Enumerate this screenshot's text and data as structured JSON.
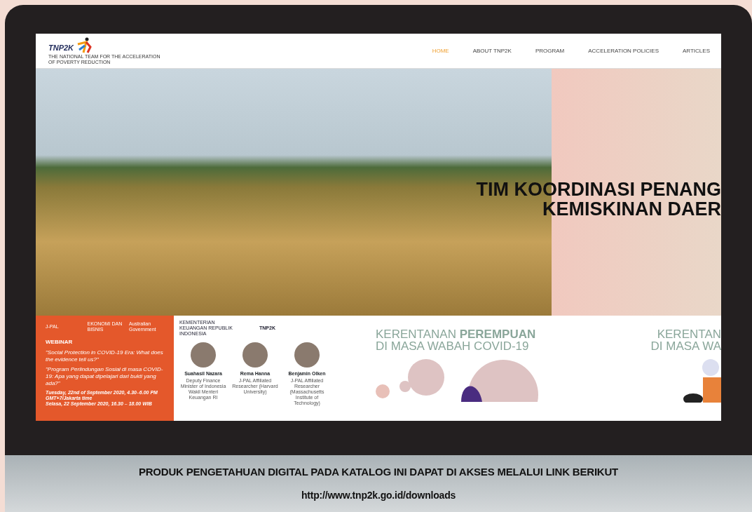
{
  "site": {
    "logo": "TNP2K",
    "tagline": "THE NATIONAL TEAM FOR THE ACCELERATION OF POVERTY REDUCTION",
    "nav": [
      {
        "label": "HOME",
        "selected": true
      },
      {
        "label": "ABOUT TNP2K",
        "selected": false
      },
      {
        "label": "PROGRAM",
        "selected": false
      },
      {
        "label": "ACCELERATION POLICIES",
        "selected": false
      },
      {
        "label": "ARTICLES",
        "selected": false
      }
    ],
    "hero": {
      "lines": [
        "TIM KOORDINASI PENANG",
        "KEMISKINAN DAER"
      ]
    },
    "webinar": {
      "partners": [
        "J-PAL",
        "EKONOMI DAN BISNIS",
        "Australian Government"
      ],
      "label": "WEBINAR",
      "titles": [
        "\"Social Protection in COVID-19 Era: What does the evidence tell us?\"",
        "\"Program Perlindungan Sosial di masa COVID-19: Apa yang dapat dipelajari dari bukti yang ada?\""
      ],
      "dates": [
        "Tuesday, 22nd of September 2020, 4.30–6.00 PM GMT+7/Jakarta time",
        "Selasa, 22 September 2020, 16.30 – 18.00 WIB"
      ]
    },
    "speakers": {
      "logos": [
        "KEMENTERIAN KEUANGAN REPUBLIK INDONESIA",
        "TNP2K"
      ],
      "people": [
        {
          "name": "Suahasil Nazara",
          "role": "Deputy Finance Minister of Indonesia Wakil Menteri Keuangan RI"
        },
        {
          "name": "Rema Hanna",
          "role": "J-PAL Affiliated Researcher (Harvard University)"
        },
        {
          "name": "Benjamin Olken",
          "role": "J-PAL Affiliated Researcher (Massachusetts Institute of Technology)"
        }
      ]
    },
    "covid": [
      {
        "line1": "KERENTANAN **PEREMPUAN**",
        "line2": "DI MASA WABAH COVID-19"
      },
      {
        "line1": "KERENTAN",
        "line2": "DI MASA WA"
      }
    ]
  },
  "caption": {
    "text": "PRODUK PENGETAHUAN DIGITAL PADA KATALOG INI DAPAT DI AKSES MELALUI LINK BERIKUT",
    "link": "http://www.tnp2k.go.id/downloads"
  }
}
